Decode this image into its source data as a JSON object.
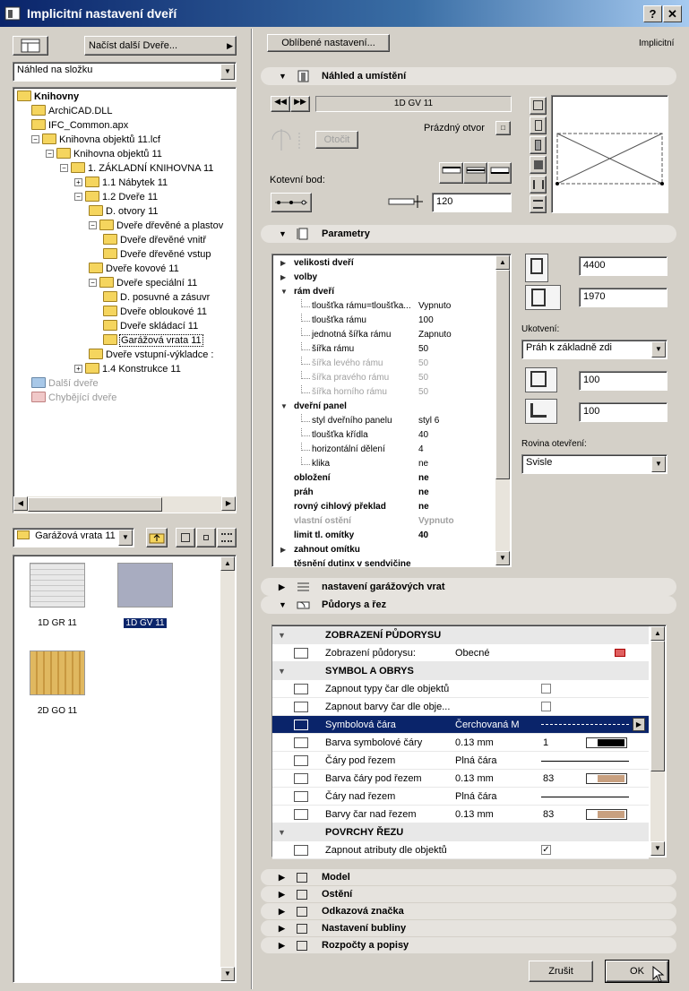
{
  "window": {
    "title": "Implicitní nastavení dveří",
    "help": "?",
    "close": "✕"
  },
  "left": {
    "load_more": "Načíst další Dveře...",
    "view_combo": "Náhled na složku",
    "tree": [
      {
        "label": "Knihovny",
        "level": 0,
        "bold": true
      },
      {
        "label": "ArchiCAD.DLL",
        "level": 1
      },
      {
        "label": "IFC_Common.apx",
        "level": 1
      },
      {
        "label": "Knihovna objektů 11.lcf",
        "level": 1,
        "pm": "−"
      },
      {
        "label": "Knihovna objektů 11",
        "level": 2,
        "pm": "−"
      },
      {
        "label": "1. ZÁKLADNÍ KNIHOVNA 11",
        "level": 3,
        "pm": "−"
      },
      {
        "label": "1.1 Nábytek 11",
        "level": 4,
        "pm": "+"
      },
      {
        "label": "1.2 Dveře 11",
        "level": 4,
        "pm": "−"
      },
      {
        "label": "D. otvory 11",
        "level": 5
      },
      {
        "label": "Dveře dřevěné a plastov",
        "level": 5,
        "pm": "−"
      },
      {
        "label": "Dveře dřevěné vnitř",
        "level": 6
      },
      {
        "label": "Dveře dřevěné vstup",
        "level": 6
      },
      {
        "label": "Dveře kovové 11",
        "level": 5
      },
      {
        "label": "Dveře speciální 11",
        "level": 5,
        "pm": "−"
      },
      {
        "label": "D. posuvné a zásuvr",
        "level": 6
      },
      {
        "label": "Dveře obloukové 11",
        "level": 6
      },
      {
        "label": "Dveře skládací 11",
        "level": 6
      },
      {
        "label": "Garážová vrata 11",
        "level": 6,
        "selected": true
      },
      {
        "label": "Dveře vstupní-výkladce :",
        "level": 5
      },
      {
        "label": "1.4 Konstrukce 11",
        "level": 4,
        "pm": "+"
      },
      {
        "label": "Další dveře",
        "level": 1,
        "special": "gray"
      },
      {
        "label": "Chybějící dveře",
        "level": 1,
        "special": "pink"
      }
    ],
    "folder_combo": "Garážová vrata 11",
    "thumbs": [
      {
        "label": "1D GR 11",
        "selected": false
      },
      {
        "label": "1D GV 11",
        "selected": true
      },
      {
        "label": "2D GO 11",
        "selected": false
      }
    ]
  },
  "right": {
    "favorites": "Oblíbené nastavení...",
    "mode": "Implicitní",
    "section_preview": "Náhled a umístění",
    "object_name": "1D GV 11",
    "empty_opening": "Prázdný otvor",
    "rotate": "Otočit",
    "anchor_label": "Kotevní bod:",
    "offset_value": "120",
    "section_params": "Parametry",
    "params": [
      {
        "label": "velikosti dveří",
        "bold": true,
        "tri": "▶",
        "indent": 0,
        "value": ""
      },
      {
        "label": "volby",
        "bold": true,
        "tri": "▶",
        "indent": 0,
        "value": ""
      },
      {
        "label": "rám dveří",
        "bold": true,
        "tri": "▼",
        "indent": 0,
        "value": ""
      },
      {
        "label": "tloušťka rámu=tloušťka...",
        "indent": 1,
        "value": "Vypnuto"
      },
      {
        "label": "tloušťka rámu",
        "indent": 1,
        "value": "100"
      },
      {
        "label": "jednotná šířka rámu",
        "indent": 1,
        "value": "Zapnuto"
      },
      {
        "label": "šířka rámu",
        "indent": 1,
        "value": "50"
      },
      {
        "label": "šířka levého rámu",
        "indent": 1,
        "value": "50",
        "dim": true
      },
      {
        "label": "šířka pravého rámu",
        "indent": 1,
        "value": "50",
        "dim": true
      },
      {
        "label": "šířka horního rámu",
        "indent": 1,
        "value": "50",
        "dim": true
      },
      {
        "label": "dveřní panel",
        "bold": true,
        "tri": "▼",
        "indent": 0,
        "value": ""
      },
      {
        "label": "styl dveřního panelu",
        "indent": 1,
        "value": "styl 6"
      },
      {
        "label": "tloušťka křídla",
        "indent": 1,
        "value": "40"
      },
      {
        "label": "horizontální dělení",
        "indent": 1,
        "value": "4"
      },
      {
        "label": "klika",
        "indent": 1,
        "value": "ne"
      },
      {
        "label": "obložení",
        "bold": true,
        "indent": 0,
        "value": "ne",
        "bv": true
      },
      {
        "label": "práh",
        "bold": true,
        "indent": 0,
        "value": "ne",
        "bv": true
      },
      {
        "label": "rovný cihlový překlad",
        "bold": true,
        "indent": 0,
        "value": "ne",
        "bv": true
      },
      {
        "label": "vlastní ostění",
        "bold": true,
        "indent": 0,
        "value": "Vypnuto",
        "dim": true,
        "bv": true
      },
      {
        "label": "limit tl. omítky",
        "bold": true,
        "indent": 0,
        "value": "40",
        "bv": true
      },
      {
        "label": "zahnout omítku",
        "bold": true,
        "tri": "▶",
        "indent": 0,
        "value": ""
      },
      {
        "label": "těsnění dutinx v sendvičine",
        "bold": true,
        "indent": 0,
        "value": ""
      }
    ],
    "width": "4400",
    "height": "1970",
    "anchor_caption": "Ukotvení:",
    "anchor_combo": "Práh k základně zdi",
    "sill1": "100",
    "sill2": "100",
    "opening_caption": "Rovina otevření:",
    "opening_combo": "Svisle",
    "section_garage": "nastavení garážových vrat",
    "section_plan": "Půdorys a řez",
    "table": [
      {
        "type": "head",
        "c1": "ZOBRAZENÍ PŮDORYSU"
      },
      {
        "c1": "Zobrazení půdorysu:",
        "c2": "Obecné",
        "c3": "",
        "extra": "red-icon"
      },
      {
        "type": "head",
        "c1": "SYMBOL A OBRYS"
      },
      {
        "c1": "Zapnout typy čar dle objektů",
        "c2": "",
        "c3": "",
        "extra": "checkbox"
      },
      {
        "c1": "Zapnout barvy čar dle obje...",
        "c2": "",
        "c3": "",
        "extra": "checkbox"
      },
      {
        "c1": "Symbolová čára",
        "c2": "Čerchovaná M",
        "c3": "",
        "extra": "dashline",
        "selected": true
      },
      {
        "c1": "Barva symbolové čáry",
        "c2": "0.13 mm",
        "c3": "1",
        "extra": "black-swatch"
      },
      {
        "c1": "Čáry pod řezem",
        "c2": "Plná čára",
        "c3": "",
        "extra": "solidline"
      },
      {
        "c1": "Barva čáry pod řezem",
        "c2": "0.13 mm",
        "c3": "83",
        "extra": "tan-swatch"
      },
      {
        "c1": "Čáry nad řezem",
        "c2": "Plná čára",
        "c3": "",
        "extra": "solidline"
      },
      {
        "c1": "Barvy čar nad řezem",
        "c2": "0.13 mm",
        "c3": "83",
        "extra": "tan-swatch"
      },
      {
        "type": "head",
        "c1": "POVRCHY ŘEZU"
      },
      {
        "c1": "Zapnout atributy dle objektů",
        "c2": "",
        "c3": "",
        "extra": "checked"
      }
    ],
    "bottom_sections": [
      "Model",
      "Ostění",
      "Odkazová značka",
      "Nastavení bubliny",
      "Rozpočty a popisy"
    ],
    "cancel": "Zrušit",
    "ok": "OK"
  },
  "colors": {
    "title_start": "#0a246a",
    "title_end": "#a6caf0",
    "selection": "#0a246a",
    "tan": "#c8a080"
  }
}
